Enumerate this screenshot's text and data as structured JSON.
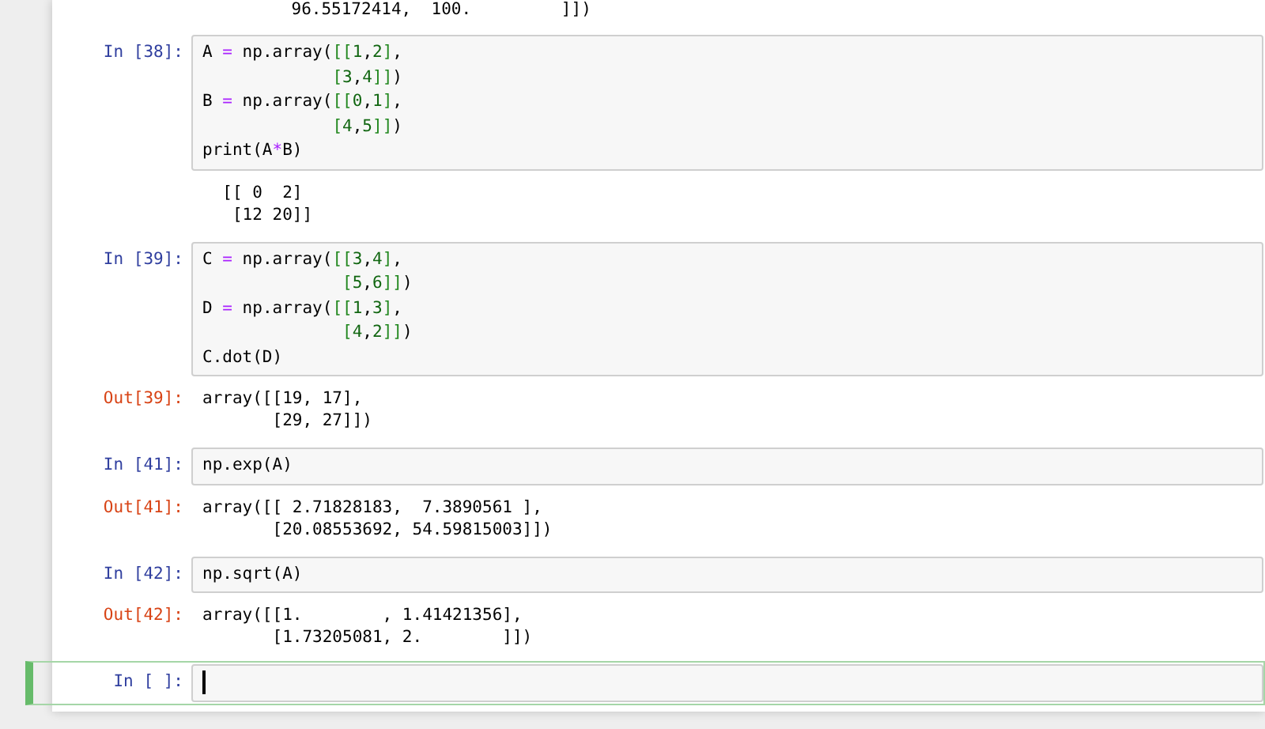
{
  "top_output": {
    "lines": [
      "       96.55172414,  100.         ]])"
    ]
  },
  "cells": [
    {
      "prompt": "In [38]:",
      "selected": false,
      "code": [
        "A = np.array([[1,2],",
        "             [3,4]])",
        "B = np.array([[0,1],",
        "             [4,5]])",
        "print(A*B)"
      ],
      "output": {
        "lines": [
          "[[ 0  2]",
          " [12 20]]"
        ]
      }
    },
    {
      "prompt": "In [39]:",
      "selected": false,
      "code": [
        "C = np.array([[3,4],",
        "              [5,6]])",
        "D = np.array([[1,3],",
        "              [4,2]])",
        "C.dot(D)"
      ],
      "output": {
        "prompt": "Out[39]:",
        "lines": [
          "array([[19, 17],",
          "       [29, 27]])"
        ]
      }
    },
    {
      "prompt": "In [41]:",
      "selected": false,
      "code": [
        "np.exp(A)"
      ],
      "output": {
        "prompt": "Out[41]:",
        "lines": [
          "array([[ 2.71828183,  7.3890561 ],",
          "       [20.08553692, 54.59815003]])"
        ]
      }
    },
    {
      "prompt": "In [42]:",
      "selected": false,
      "code": [
        "np.sqrt(A)"
      ],
      "output": {
        "prompt": "Out[42]:",
        "lines": [
          "array([[1.        , 1.41421356],",
          "       [1.73205081, 2.        ]])"
        ]
      }
    },
    {
      "prompt": "In [ ]:",
      "selected": true
    }
  ]
}
